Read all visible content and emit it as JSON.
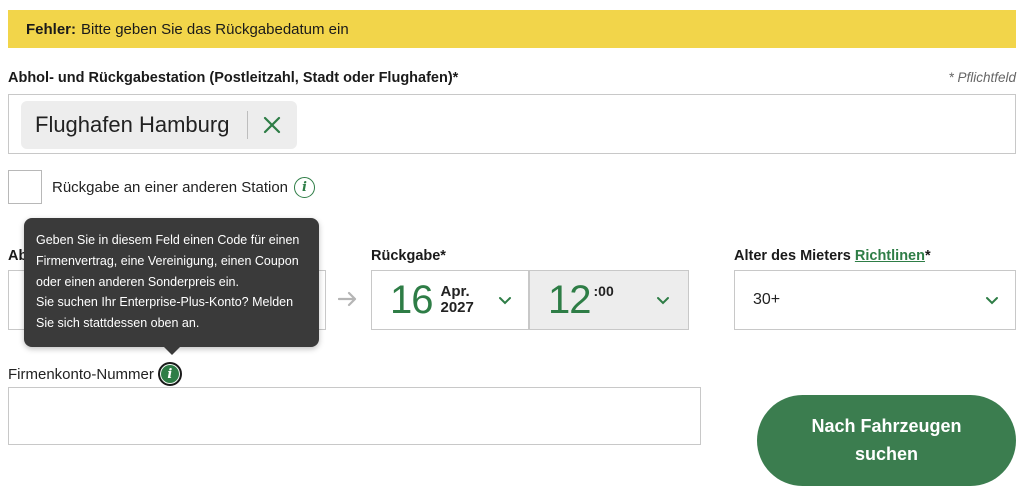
{
  "error_banner": {
    "prefix": "Fehler:",
    "message": "Bitte geben Sie das Rückgabedatum ein"
  },
  "station": {
    "label": "Abhol- und Rückgabestation (Postleitzahl, Stadt oder Flughafen)*",
    "required_note": "* Pflichtfeld",
    "selected_value": "Flughafen Hamburg",
    "clear_icon": "close-icon"
  },
  "different_return": {
    "label": "Rückgabe an einer anderen Station",
    "checked": false,
    "info_icon": "info-icon"
  },
  "pickup": {
    "label_partial": "Ab"
  },
  "return": {
    "label": "Rückgabe*",
    "day": "16",
    "month": "Apr.",
    "year": "2027",
    "hour": "12",
    "minutes": ":00"
  },
  "age": {
    "label": "Alter des Mieters",
    "link": "Richtlinen",
    "asterisk": "*",
    "selected_value": "30+"
  },
  "account": {
    "label": "Firmenkonto-Nummer",
    "value": ""
  },
  "tooltip": {
    "line1": "Geben Sie in diesem Feld einen Code für einen",
    "line2": "Firmenvertrag, eine Vereinigung, einen Coupon",
    "line3": "oder einen anderen Sonderpreis ein.",
    "line4": "Sie suchen Ihr Enterprise-Plus-Konto? Melden",
    "line5": "Sie sich stattdessen oben an."
  },
  "search_button": {
    "line1": "Nach Fahrzeugen",
    "line2": "suchen"
  },
  "colors": {
    "brand_green": "#2e7d46",
    "button_green": "#3b7d4f",
    "error_yellow": "#f2d54a",
    "tooltip_bg": "#3a3a3a"
  }
}
